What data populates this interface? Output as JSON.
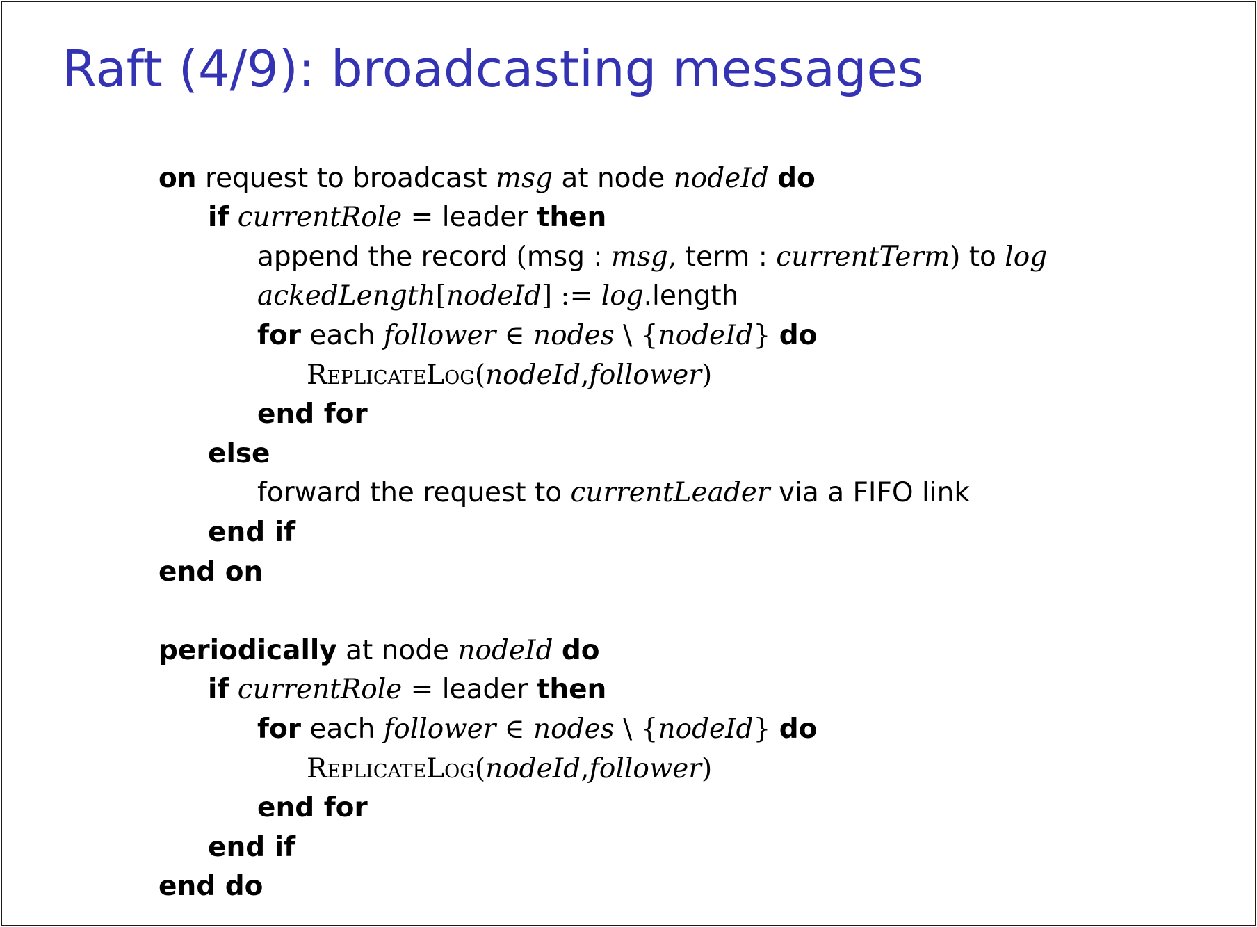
{
  "slide": {
    "title": "Raft (4/9): broadcasting messages"
  },
  "algorithm": {
    "on_request": {
      "l1_on": "on",
      "l1_text": "request to broadcast",
      "l1_msg": "msg",
      "l1_at_node": "at node",
      "l1_nodeid": "nodeId",
      "l1_do": "do",
      "l2_if": "if",
      "l2_role": "currentRole",
      "l2_eq": "=",
      "l2_leader": "leader",
      "l2_then": "then",
      "l3_text1": "append the record",
      "l3_paren_open": "(",
      "l3_msg_key": "msg",
      "l3_colon1": ":",
      "l3_msg_val": "msg",
      "l3_comma": ",",
      "l3_term_key": "term",
      "l3_colon2": ":",
      "l3_term_val": "currentTerm",
      "l3_paren_close": ")",
      "l3_to": "to",
      "l3_log": "log",
      "l4_acked": "ackedLength",
      "l4_br_open": "[",
      "l4_nodeid": "nodeId",
      "l4_br_close": "]",
      "l4_assign": ":=",
      "l4_log": "log",
      "l4_length": ".length",
      "l5_for": "for",
      "l5_each": "each",
      "l5_follower": "follower",
      "l5_in": "∈",
      "l5_nodes": "nodes",
      "l5_minus": "\\",
      "l5_brace_open": "{",
      "l5_nodeid": "nodeId",
      "l5_brace_close": "}",
      "l5_do": "do",
      "l6_func": "ReplicateLog",
      "l6_paren_open": "(",
      "l6_nodeid": "nodeId",
      "l6_comma": ",",
      "l6_follower": "follower",
      "l6_paren_close": ")",
      "l7_endfor": "end for",
      "l8_else": "else",
      "l9_text1": "forward the request to",
      "l9_leader": "currentLeader",
      "l9_text2": "via a FIFO link",
      "l10_endif": "end if",
      "l11_endon": "end on"
    },
    "periodically": {
      "l1_periodically": "periodically",
      "l1_at_node": "at node",
      "l1_nodeid": "nodeId",
      "l1_do": "do",
      "l2_if": "if",
      "l2_role": "currentRole",
      "l2_eq": "=",
      "l2_leader": "leader",
      "l2_then": "then",
      "l3_for": "for",
      "l3_each": "each",
      "l3_follower": "follower",
      "l3_in": "∈",
      "l3_nodes": "nodes",
      "l3_minus": "\\",
      "l3_brace_open": "{",
      "l3_nodeid": "nodeId",
      "l3_brace_close": "}",
      "l3_do": "do",
      "l4_func": "ReplicateLog",
      "l4_paren_open": "(",
      "l4_nodeid": "nodeId",
      "l4_comma": ",",
      "l4_follower": "follower",
      "l4_paren_close": ")",
      "l5_endfor": "end for",
      "l6_endif": "end if",
      "l7_enddo": "end do"
    }
  },
  "colors": {
    "title": "#3333b3",
    "text": "#000000",
    "border": "#1a1a1a",
    "background": "#ffffff"
  }
}
